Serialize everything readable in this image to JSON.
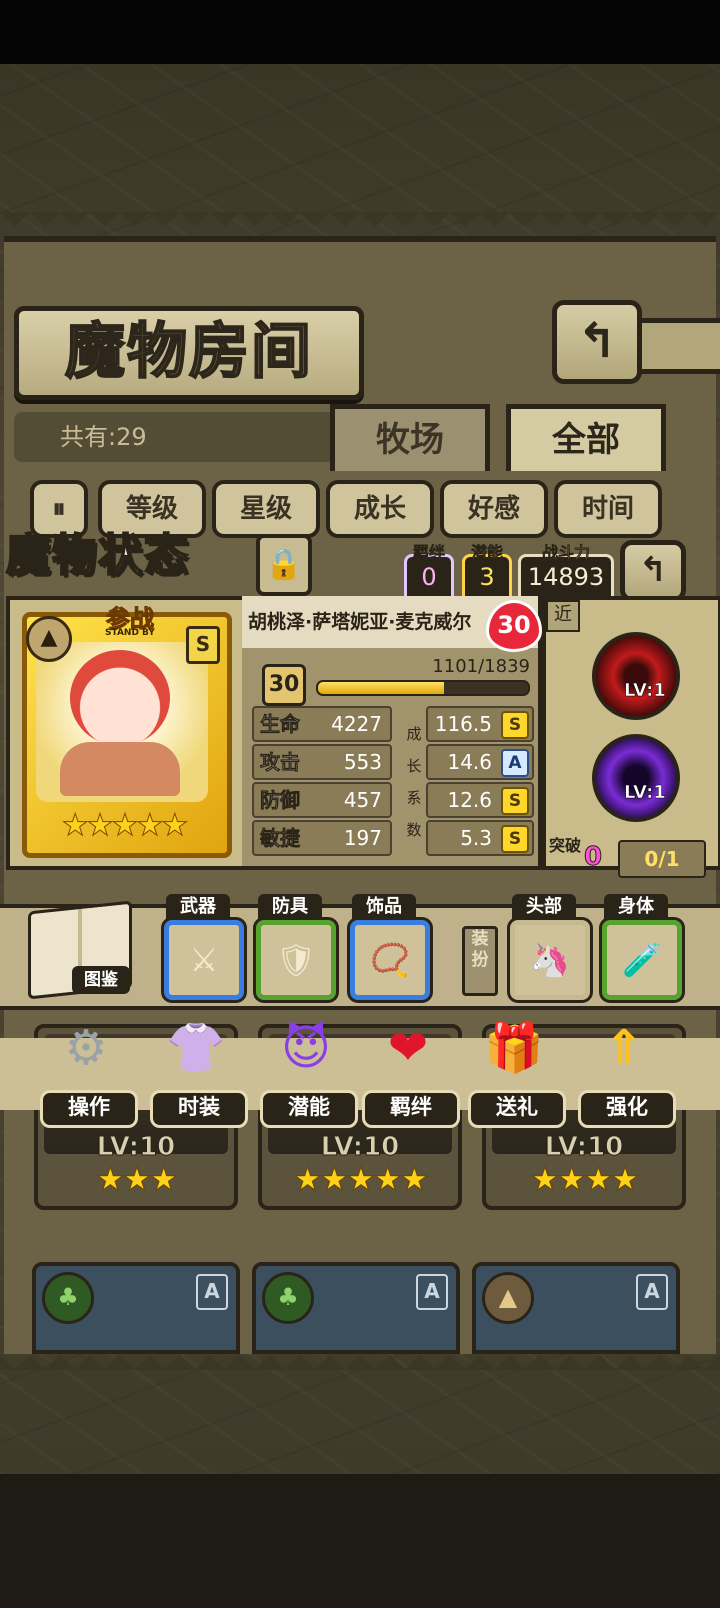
{
  "room": {
    "title": "魔物房间",
    "count_label": "共有:29"
  },
  "tabs": [
    {
      "label": "牧场"
    },
    {
      "label": "全部"
    }
  ],
  "sort": {
    "toggle": "⏸",
    "buttons": [
      {
        "label": "等级"
      },
      {
        "label": "星级"
      },
      {
        "label": "成长"
      },
      {
        "label": "好感"
      },
      {
        "label": "时间"
      }
    ]
  },
  "status": {
    "title": "魔物状态",
    "bond": {
      "label": "羁绊",
      "value": "0"
    },
    "potential": {
      "label": "潜能",
      "value": "3"
    },
    "power": {
      "label": "战斗力",
      "value": "14893"
    }
  },
  "monster": {
    "name": "胡桃泽·萨塔妮亚·麦克威尔",
    "affinity": "30",
    "standby": "参战",
    "standby_sub": "STAND BY",
    "rarity_grade": "S",
    "stars": "★★★★★",
    "level": "30",
    "exp_text": "1101/1839",
    "exp_fraction": 0.599,
    "stats": [
      {
        "label": "生命",
        "value": "4227",
        "growth": "116.5",
        "grade": "S"
      },
      {
        "label": "攻击",
        "value": "553",
        "growth": "14.6",
        "grade": "A"
      },
      {
        "label": "防御",
        "value": "457",
        "growth": "12.6",
        "grade": "S"
      },
      {
        "label": "敏捷",
        "value": "197",
        "growth": "5.3",
        "grade": "S"
      }
    ],
    "growth_vertical": [
      "成",
      "长",
      "系",
      "数"
    ]
  },
  "skills": {
    "range_tag": "近",
    "items": [
      {
        "lv": "LV:1"
      },
      {
        "lv": "LV:1"
      }
    ],
    "breakthrough": {
      "label": "突破",
      "count": "0",
      "progress": "0/1"
    }
  },
  "equipment": {
    "book_label": "图鉴",
    "weapon": "武器",
    "armor": "防具",
    "accessory": "饰品",
    "dress_label": "装扮",
    "head": "头部",
    "body": "身体"
  },
  "actions": [
    {
      "label": "操作",
      "icon": "⚙"
    },
    {
      "label": "时装",
      "icon": "👚"
    },
    {
      "label": "潜能",
      "icon": "😈"
    },
    {
      "label": "羁绊",
      "icon": "❤"
    },
    {
      "label": "送礼",
      "icon": "🎁"
    },
    {
      "label": "强化",
      "icon": "⇑"
    }
  ],
  "cards": [
    {
      "lv": "LV:10",
      "stars": "★★★"
    },
    {
      "lv": "LV:10",
      "stars": "★★★★★"
    },
    {
      "lv": "LV:10",
      "stars": "★★★★"
    }
  ],
  "cards_bottom": [
    {
      "a": "A"
    },
    {
      "a": "A"
    },
    {
      "a": "A"
    }
  ],
  "colors": {
    "accent_gold": "#ffd21a",
    "grade_s": "#ffd62a",
    "grade_a": "#d6eaff",
    "affinity_red": "#e8283a"
  }
}
